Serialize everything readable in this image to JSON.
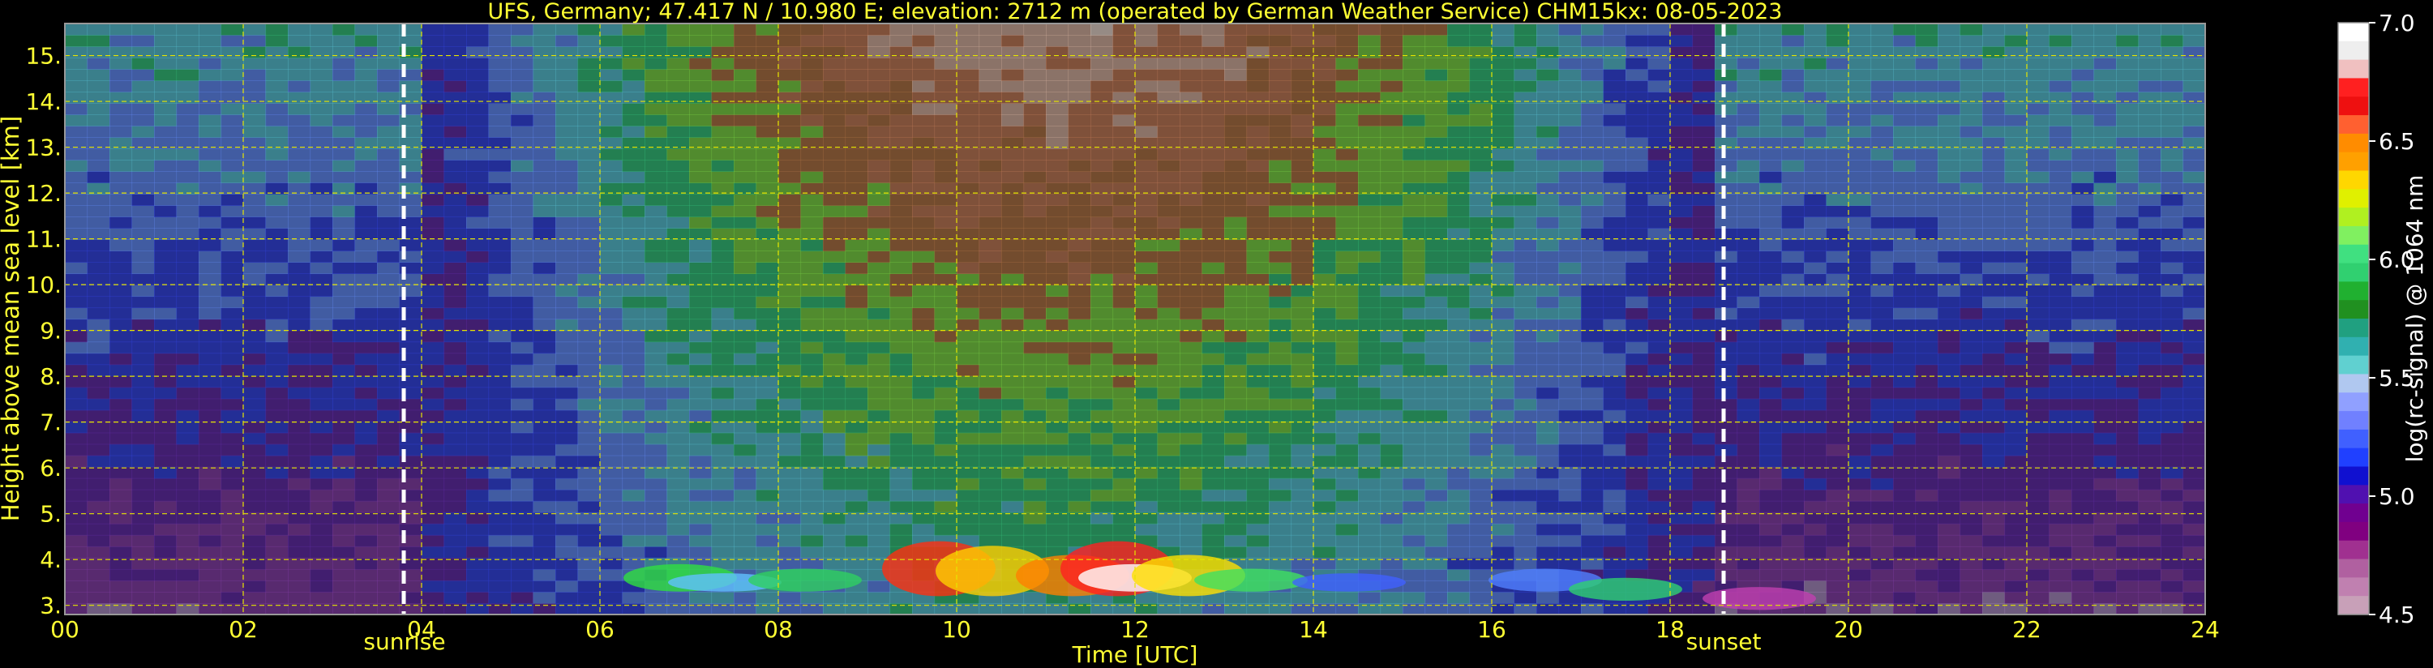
{
  "chart_data": {
    "type": "heatmap",
    "title": "UFS, Germany; 47.417 N / 10.980 E; elevation: 2712 m  (operated by German Weather Service)    CHM15kx: 08-05-2023",
    "xlabel": "Time [UTC]",
    "ylabel": "Height above mean sea level [km]",
    "xlim": [
      0,
      24
    ],
    "ylim": [
      2.8,
      15.7
    ],
    "x_ticks": [
      "00",
      "02",
      "04",
      "06",
      "08",
      "10",
      "12",
      "14",
      "16",
      "18",
      "20",
      "22",
      "24"
    ],
    "y_ticks": [
      "3.",
      "4.",
      "5.",
      "6.",
      "7.",
      "8.",
      "9.",
      "10.",
      "11.",
      "12.",
      "13.",
      "14.",
      "15."
    ],
    "grid": true,
    "sunrise": {
      "label": "sunrise",
      "time": 3.8
    },
    "sunset": {
      "label": "sunset",
      "time": 18.6
    },
    "colorbar": {
      "label": "log(rc-signal) @ 1064 nm",
      "range": [
        4.5,
        7.0
      ],
      "ticks": [
        "7.0",
        "6.5",
        "6.0",
        "5.5",
        "5.0",
        "4.5"
      ],
      "tick_values": [
        7.0,
        6.5,
        6.0,
        5.5,
        5.0,
        4.5
      ],
      "colors": [
        "#ffffff",
        "#eeeeee",
        "#f0c0c0",
        "#ff2020",
        "#ee1010",
        "#ff6030",
        "#ff8c00",
        "#ffa000",
        "#ffd700",
        "#e0f000",
        "#b0f020",
        "#80f060",
        "#40e080",
        "#30d070",
        "#20b030",
        "#209020",
        "#20a080",
        "#30b0b0",
        "#60d0d0",
        "#b0c8f0",
        "#90a0ff",
        "#7080ff",
        "#4060ff",
        "#2040ff",
        "#1010d0",
        "#5010b0",
        "#700090",
        "#800080",
        "#a03090",
        "#b060a0",
        "#c080b0",
        "#c8a0b8"
      ]
    }
  }
}
